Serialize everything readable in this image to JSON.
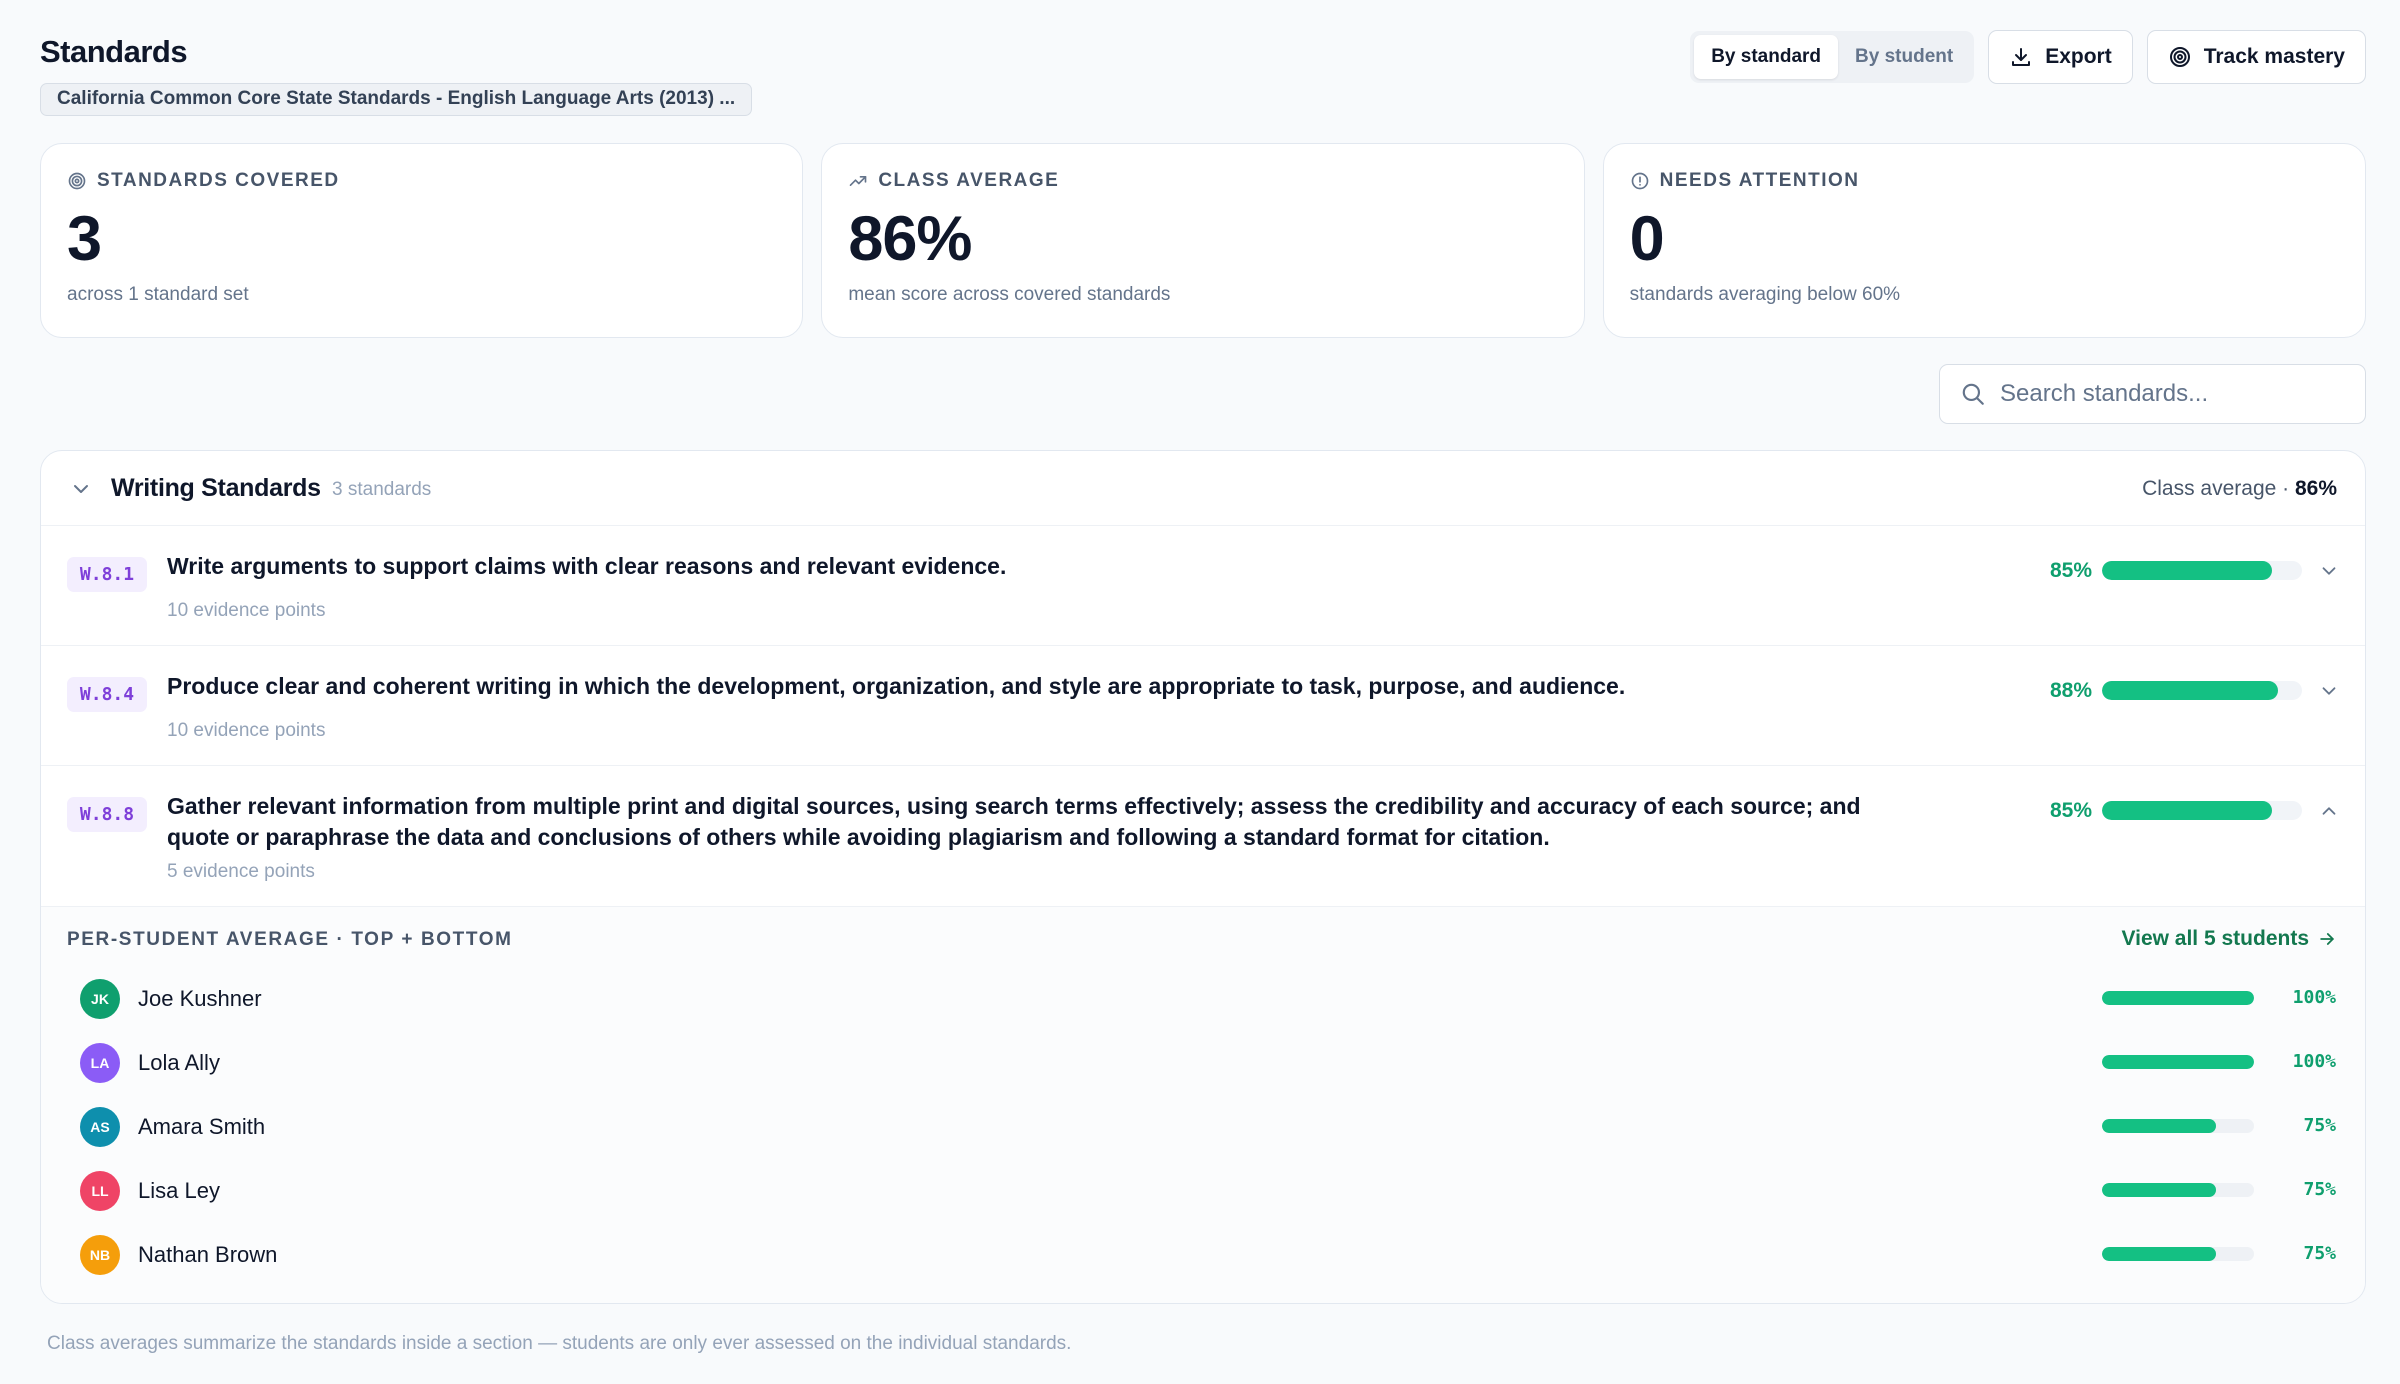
{
  "page": {
    "title": "Standards",
    "standard_set": "California Common Core State Standards - English Language Arts (2013) ..."
  },
  "toolbar": {
    "view_toggle": [
      "By standard",
      "By student"
    ],
    "active_view": "By standard",
    "export_label": "Export",
    "track_label": "Track mastery"
  },
  "cards": [
    {
      "label": "STANDARDS COVERED",
      "value": "3",
      "sub": "across 1 standard set",
      "icon": "target-icon"
    },
    {
      "label": "CLASS AVERAGE",
      "value": "86%",
      "sub": "mean score across covered standards",
      "icon": "trending-up-icon"
    },
    {
      "label": "NEEDS ATTENTION",
      "value": "0",
      "sub": "standards averaging below 60%",
      "icon": "alert-circle-icon"
    }
  ],
  "search": {
    "placeholder": "Search standards..."
  },
  "section": {
    "title": "Writing Standards",
    "count": "3 standards",
    "avg_label": "Class average · ",
    "avg_value": "86%",
    "standards": [
      {
        "code": "W.8.1",
        "text": "Write arguments to support claims with clear reasons and relevant evidence.",
        "evidence": "10 evidence points",
        "pct_label": "85%",
        "pct": 85,
        "expanded": false
      },
      {
        "code": "W.8.4",
        "text": "Produce clear and coherent writing in which the development, organization, and style are appropriate to task, purpose, and audience.",
        "evidence": "10 evidence points",
        "pct_label": "88%",
        "pct": 88,
        "expanded": false
      },
      {
        "code": "W.8.8",
        "text": "Gather relevant information from multiple print and digital sources, using search terms effectively; assess the credibility and accuracy of each source; and quote or paraphrase the data and conclusions of others while avoiding plagiarism and following a standard format for citation.",
        "evidence": "5 evidence points",
        "pct_label": "85%",
        "pct": 85,
        "expanded": true
      }
    ],
    "expanded_panel": {
      "label": "PER-STUDENT AVERAGE · TOP + BOTTOM",
      "view_all": "View all 5 students",
      "students": [
        {
          "initials": "JK",
          "name": "Joe Kushner",
          "pct_label": "100%",
          "pct": 100,
          "color": "#0f9f6e"
        },
        {
          "initials": "LA",
          "name": "Lola Ally",
          "pct_label": "100%",
          "pct": 100,
          "color": "#8b5cf6"
        },
        {
          "initials": "AS",
          "name": "Amara Smith",
          "pct_label": "75%",
          "pct": 75,
          "color": "#0e8fad"
        },
        {
          "initials": "LL",
          "name": "Lisa Ley",
          "pct_label": "75%",
          "pct": 75,
          "color": "#ef4466"
        },
        {
          "initials": "NB",
          "name": "Nathan Brown",
          "pct_label": "75%",
          "pct": 75,
          "color": "#f59e0b"
        }
      ]
    }
  },
  "footnote": "Class averages summarize the standards inside a section — students are only ever assessed on the individual standards.",
  "colors": {
    "accent": "#14c083",
    "accent_text": "#0f9f6e",
    "code_chip_bg": "#f3eefe",
    "code_chip_text": "#7e3fd9"
  }
}
